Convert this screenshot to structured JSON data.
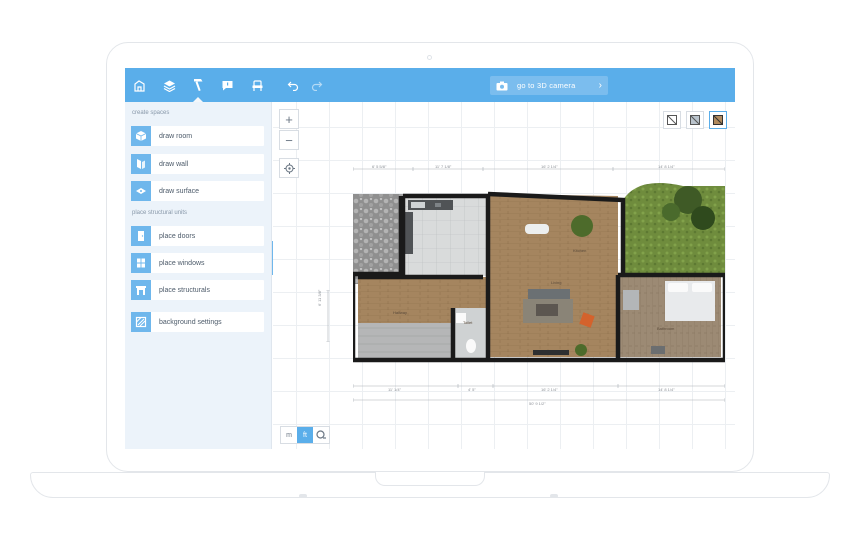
{
  "topbar": {
    "tools": [
      {
        "name": "building-icon"
      },
      {
        "name": "layers-icon"
      },
      {
        "name": "hammer-icon"
      },
      {
        "name": "comment-icon"
      },
      {
        "name": "chair-icon"
      }
    ],
    "active_tool_index": 2,
    "camera_button": {
      "label": "go to 3D camera",
      "icon": "camera-icon"
    },
    "accent_color": "#5aaeea"
  },
  "sidebar": {
    "create_spaces_title": "create spaces",
    "create_items": [
      {
        "label": "draw room"
      },
      {
        "label": "draw wall"
      },
      {
        "label": "draw surface"
      }
    ],
    "structural_title": "place structural units",
    "structural_items": [
      {
        "label": "place doors"
      },
      {
        "label": "place windows"
      },
      {
        "label": "place structurals"
      }
    ],
    "background_item": {
      "label": "background settings"
    }
  },
  "canvas": {
    "units": {
      "metric": "m",
      "imperial": "ft",
      "active": "ft"
    },
    "top_dimensions": [
      "6' 5 5/8\"",
      "11' 7 1/8\"",
      "16' 2 1/4\"",
      "14' 8 1/4\""
    ],
    "left_dimension": "6' 11 3/8\"",
    "bottom_dimensions": [
      "11' 1/4\"",
      "4' 5\"",
      "16' 2 1/4\"",
      "14' 8 1/4\""
    ],
    "total_dimension": "50' 9 1/2\"",
    "rooms": {
      "kitchen": "Kitchen",
      "living": "Living",
      "hallway": "Hallway",
      "toilet": "Toilet",
      "bathroom": "Bathroom"
    }
  }
}
